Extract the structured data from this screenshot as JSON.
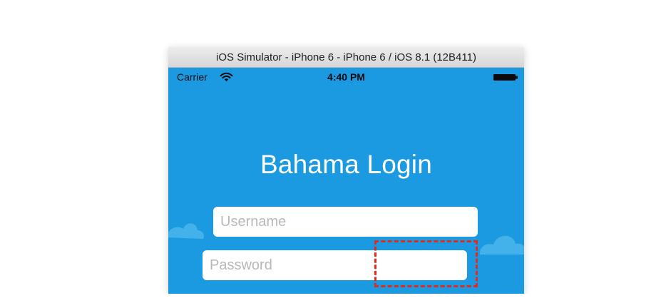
{
  "window": {
    "title": "iOS Simulator - iPhone 6 - iPhone 6 / iOS 8.1 (12B411)"
  },
  "statusbar": {
    "carrier": "Carrier",
    "time": "4:40 PM",
    "wifi_icon": "wifi-icon",
    "battery_icon": "battery-icon"
  },
  "login": {
    "title": "Bahama Login",
    "username_placeholder": "Username",
    "password_placeholder": "Password"
  },
  "colors": {
    "screen_background": "#1b9ae1",
    "field_background": "#ffffff",
    "placeholder_text": "#b8b8b8",
    "highlight": "#e12b1f"
  }
}
